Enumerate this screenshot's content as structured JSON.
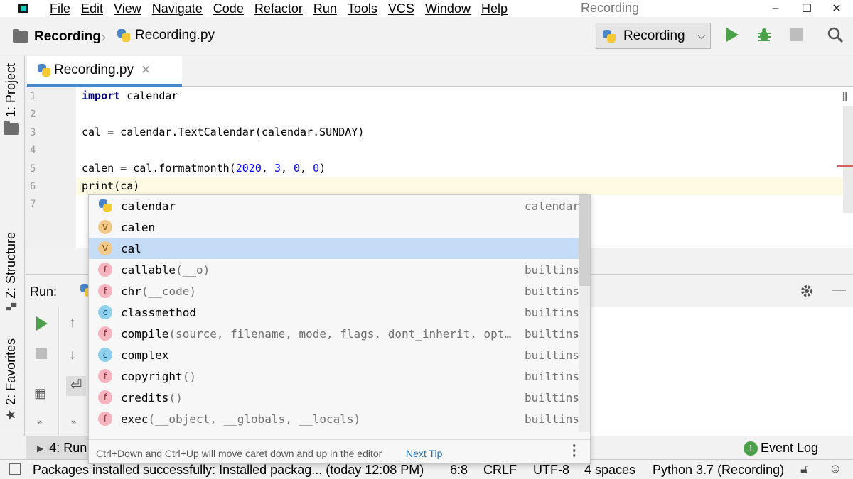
{
  "menu": [
    "File",
    "Edit",
    "View",
    "Navigate",
    "Code",
    "Refactor",
    "Run",
    "Tools",
    "VCS",
    "Window",
    "Help"
  ],
  "window_title": "Recording",
  "window_controls": {
    "minimize": "–",
    "maximize": "☐",
    "close": "✕"
  },
  "breadcrumb": {
    "project": "Recording",
    "file": "Recording.py"
  },
  "run_config": {
    "label": "Recording"
  },
  "side_tabs": {
    "project": "1: Project",
    "structure": "Z: Structure",
    "favorites": "2: Favorites"
  },
  "editor": {
    "tab": {
      "label": "Recording.py"
    },
    "line_numbers": [
      "1",
      "2",
      "3",
      "4",
      "5",
      "6",
      "7"
    ],
    "lines": [
      {
        "kw": "import",
        "rest": " calendar"
      },
      {
        "text": ""
      },
      {
        "text": "cal = calendar.TextCalendar(calendar.SUNDAY)"
      },
      {
        "text": ""
      },
      {
        "pre": "calen = cal.formatmonth(",
        "n1": "2020",
        "s1": ", ",
        "n2": "3",
        "s2": ", ",
        "n3": "0",
        "s3": ", ",
        "n4": "0",
        "post": ")"
      },
      {
        "text": "print(ca)"
      },
      {
        "text": ""
      }
    ]
  },
  "run_panel": {
    "label": "Run:"
  },
  "completion": {
    "items": [
      {
        "icon": "module",
        "name": "calendar",
        "params": "",
        "type": "calendar"
      },
      {
        "icon": "v",
        "name": "calen",
        "params": "",
        "type": ""
      },
      {
        "icon": "v",
        "name": "cal",
        "params": "",
        "type": "",
        "selected": true
      },
      {
        "icon": "f",
        "name": "callable",
        "params": "(__o)",
        "type": "builtins"
      },
      {
        "icon": "f",
        "name": "chr",
        "params": "(__code)",
        "type": "builtins"
      },
      {
        "icon": "c",
        "name": "classmethod",
        "params": "",
        "type": "builtins"
      },
      {
        "icon": "f",
        "name": "compile",
        "params": "(source, filename, mode, flags, dont_inherit, opt…",
        "type": "builtins"
      },
      {
        "icon": "c",
        "name": "complex",
        "params": "",
        "type": "builtins"
      },
      {
        "icon": "f",
        "name": "copyright",
        "params": "()",
        "type": "builtins"
      },
      {
        "icon": "f",
        "name": "credits",
        "params": "()",
        "type": "builtins"
      },
      {
        "icon": "f",
        "name": "exec",
        "params": "(__object, __globals, __locals)",
        "type": "builtins"
      }
    ],
    "hint": "Ctrl+Down and Ctrl+Up will move caret down and up in the editor",
    "next_tip": "Next Tip"
  },
  "bottom_tabs": {
    "run": "4: Run",
    "event_log": "Event Log",
    "event_count": "1"
  },
  "status_bar": {
    "message": "Packages installed successfully: Installed packag... (today 12:08 PM)",
    "position": "6:8",
    "line_sep": "CRLF",
    "encoding": "UTF-8",
    "indent": "4 spaces",
    "interpreter": "Python 3.7 (Recording)"
  },
  "colors": {
    "accent": "#4a88c7",
    "run_green": "#4aa14a",
    "selection": "#c5dcf6",
    "keyword": "#000080",
    "number": "#0000ff"
  }
}
